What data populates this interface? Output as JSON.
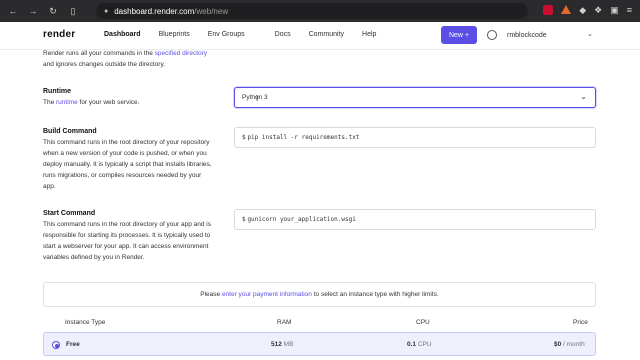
{
  "browser": {
    "url_host": "dashboard.render.com",
    "url_path": "/web/new"
  },
  "header": {
    "logo": "render",
    "nav": [
      "Dashboard",
      "Blueprints",
      "Env Groups",
      "Docs",
      "Community",
      "Help"
    ],
    "new_button": "New",
    "new_button_icon": "+",
    "username": "rmblockcode"
  },
  "intro": {
    "line1_prefix": "Render runs all your commands in the ",
    "line1_link": "specified directory",
    "line2": "and ignores changes outside the directory."
  },
  "runtime": {
    "title": "Runtime",
    "desc_prefix": "The ",
    "desc_link": "runtime",
    "desc_suffix": " for your web service.",
    "value": "Python 3"
  },
  "build": {
    "title": "Build Command",
    "desc": "This command runs in the root directory of your repository when a new version of your code is pushed, or when you deploy manually. It is typically a script that installs libraries, runs migrations, or compiles resources needed by your app.",
    "prompt": "$",
    "value": "pip install -r requirements.txt"
  },
  "start": {
    "title": "Start Command",
    "desc": "This command runs in the root directory of your app and is responsible for starting its processes. It is typically used to start a webserver for your app. It can access environment variables defined by you in Render.",
    "prompt": "$",
    "value": "gunicorn your_application.wsgi"
  },
  "payment_notice": {
    "prefix": "Please ",
    "link": "enter your payment information",
    "suffix": " to select an instance type with higher limits."
  },
  "instance_table": {
    "headers": {
      "type": "Instance Type",
      "ram": "RAM",
      "cpu": "CPU",
      "price": "Price"
    },
    "rows": [
      {
        "type": "Free",
        "ram_value": "512",
        "ram_unit": "MB",
        "cpu_value": "0.1",
        "cpu_unit": "CPU",
        "price_value": "$0",
        "price_unit": "/ month",
        "selected": true
      }
    ]
  },
  "colors": {
    "accent": "#5b4ee5",
    "selected_row": "#eef0fb"
  }
}
